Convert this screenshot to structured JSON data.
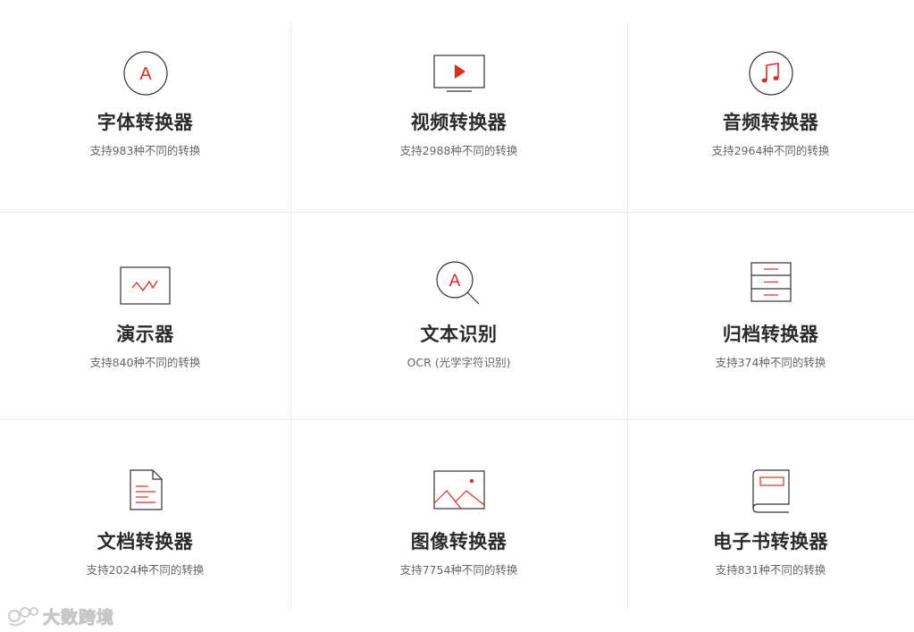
{
  "colors": {
    "accent": "#e02b20",
    "title": "#2b2b2b",
    "subtitle": "#666666",
    "divider": "#ececec",
    "icon_outline": "#333333"
  },
  "converters": [
    {
      "icon": "font-icon",
      "title": "字体转换器",
      "subtitle": "支持983种不同的转换"
    },
    {
      "icon": "video-icon",
      "title": "视频转换器",
      "subtitle": "支持2988种不同的转换"
    },
    {
      "icon": "music-icon",
      "title": "音频转换器",
      "subtitle": "支持2964种不同的转换"
    },
    {
      "icon": "presentation-icon",
      "title": "演示器",
      "subtitle": "支持840种不同的转换"
    },
    {
      "icon": "ocr-magnifier-icon",
      "title": "文本识别",
      "subtitle": "OCR (光学字符识别)"
    },
    {
      "icon": "archive-icon",
      "title": "归档转换器",
      "subtitle": "支持374种不同的转换"
    },
    {
      "icon": "document-icon",
      "title": "文档转换器",
      "subtitle": "支持2024种不同的转换"
    },
    {
      "icon": "image-icon",
      "title": "图像转换器",
      "subtitle": "支持7754种不同的转换"
    },
    {
      "icon": "ebook-icon",
      "title": "电子书转换器",
      "subtitle": "支持831种不同的转换"
    }
  ],
  "watermark": {
    "text": "大数跨境"
  }
}
